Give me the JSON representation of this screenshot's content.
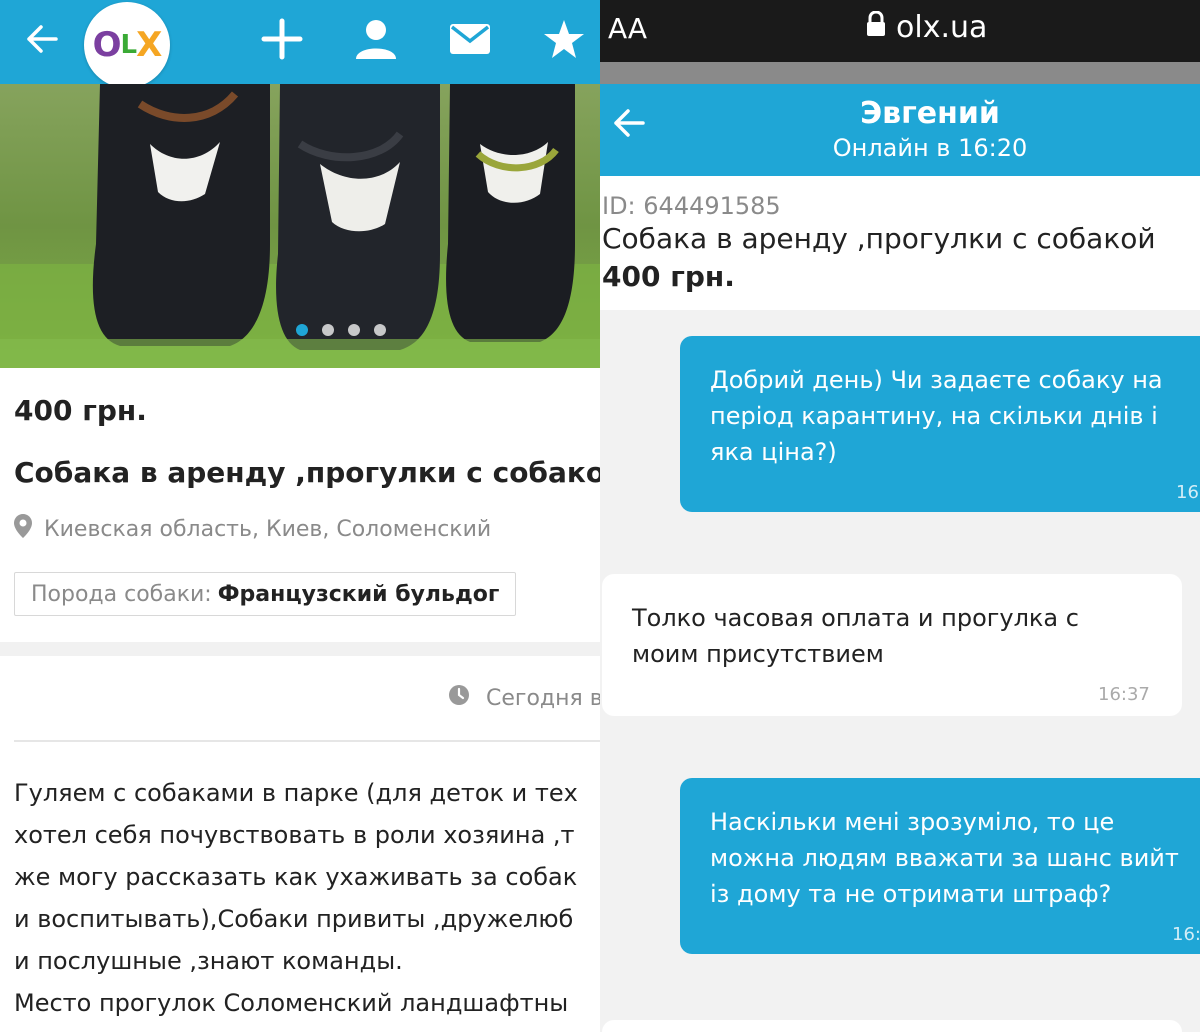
{
  "left": {
    "topbar": {
      "back_icon": "arrow-left-icon",
      "logo_letters": [
        "O",
        "L",
        "X"
      ],
      "logo_colors": [
        "#7b3fa0",
        "#3aaa35",
        "#f5a623"
      ],
      "icons": [
        "plus-icon",
        "user-icon",
        "mail-icon",
        "star-icon"
      ]
    },
    "gallery": {
      "dots": 4,
      "active": 1
    },
    "price": "400 грн.",
    "title": "Собака в аренду ,прогулки с собакой",
    "location": "Киевская область, Киев, Соломенский",
    "param": {
      "label": "Порода собаки:",
      "value": "Французский бульдог"
    },
    "date": "Сегодня в",
    "description": [
      "Гуляем с собаками в парке (для деток и тех",
      "хотел себя почувствовать в роли хозяина ,т",
      "же могу рассказать как ухаживать за собак",
      "и воспитывать),Собаки привиты ,дружелюб",
      "и послушные ,знают команды.",
      "Место прогулок Соломенский ландшафтны"
    ]
  },
  "right": {
    "browser": {
      "text_size": "AA",
      "domain": "olx.ua"
    },
    "chat": {
      "name": "Эвгений",
      "status": "Онлайн в 16:20",
      "ad": {
        "id": "ID: 644491585",
        "title": "Собака в аренду ,прогулки с собакой",
        "price": "400 грн."
      },
      "messages": [
        {
          "dir": "out",
          "lines": [
            "Добрий день) Чи задаєте собаку на",
            "період карантину, на скільки днів і",
            "яка ціна?)"
          ],
          "time": "16"
        },
        {
          "dir": "in",
          "lines": [
            "Толко часовая оплата и прогулка с",
            "моим присутствием"
          ],
          "time": "16:37"
        },
        {
          "dir": "out",
          "lines": [
            "Наскільки мені зрозуміло, то це",
            "можна людям вважати за шанс вийт",
            "із дому та не отримати штраф?"
          ],
          "time": "16:"
        }
      ]
    },
    "colors": {
      "accent": "#1fa6d6",
      "chat_bg": "#f2f2f2"
    }
  }
}
